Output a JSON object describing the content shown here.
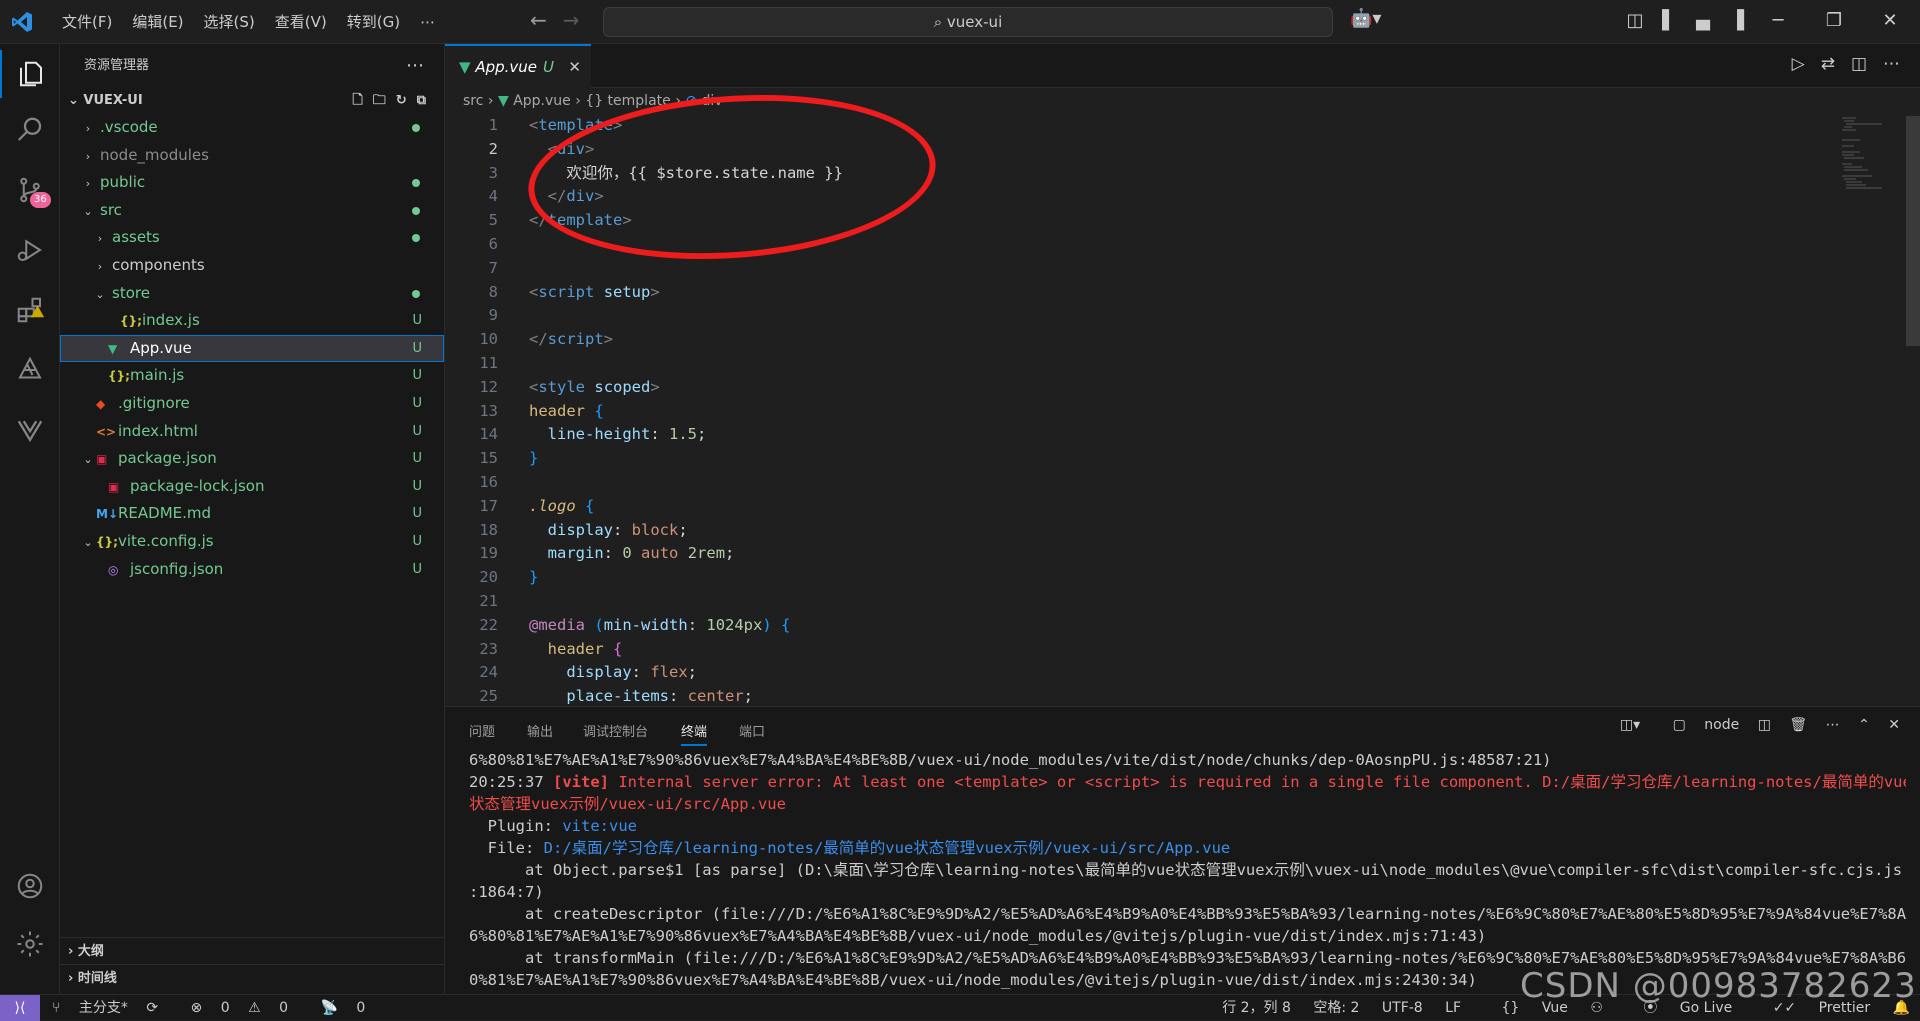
{
  "titlebar": {
    "menus": [
      "文件(F)",
      "编辑(E)",
      "选择(S)",
      "查看(V)",
      "转到(G)",
      "⋯"
    ],
    "search_text": "vuex-ui"
  },
  "activity": {
    "scm_badge": "36"
  },
  "sidebar": {
    "title": "资源管理器",
    "root": "VUEX-UI",
    "items": [
      {
        "label": ".vscode",
        "depth": 1,
        "kind": "folder",
        "status": "dot",
        "color": "#73c991"
      },
      {
        "label": "node_modules",
        "depth": 1,
        "kind": "folder",
        "status": "",
        "color": "#8c8c8c"
      },
      {
        "label": "public",
        "depth": 1,
        "kind": "folder",
        "status": "dot",
        "color": "#73c991"
      },
      {
        "label": "src",
        "depth": 1,
        "kind": "folder-open",
        "status": "dot",
        "color": "#73c991"
      },
      {
        "label": "assets",
        "depth": 2,
        "kind": "folder",
        "status": "dot",
        "color": "#73c991"
      },
      {
        "label": "components",
        "depth": 2,
        "kind": "folder",
        "status": "",
        "color": "#cccccc"
      },
      {
        "label": "store",
        "depth": 2,
        "kind": "folder-open",
        "status": "dot",
        "color": "#73c991"
      },
      {
        "label": "index.js",
        "depth": 3,
        "kind": "js",
        "status": "U",
        "color": "#73c991"
      },
      {
        "label": "App.vue",
        "depth": 2,
        "kind": "vue",
        "status": "U",
        "color": "#ffffff",
        "selected": true
      },
      {
        "label": "main.js",
        "depth": 2,
        "kind": "js",
        "status": "U",
        "color": "#73c991"
      },
      {
        "label": ".gitignore",
        "depth": 1,
        "kind": "git",
        "status": "U",
        "color": "#73c991"
      },
      {
        "label": "index.html",
        "depth": 1,
        "kind": "html",
        "status": "U",
        "color": "#73c991"
      },
      {
        "label": "package.json",
        "depth": 1,
        "kind": "pkg-open",
        "status": "U",
        "color": "#73c991"
      },
      {
        "label": "package-lock.json",
        "depth": 2,
        "kind": "pkg",
        "status": "U",
        "color": "#73c991"
      },
      {
        "label": "README.md",
        "depth": 1,
        "kind": "md",
        "status": "U",
        "color": "#73c991"
      },
      {
        "label": "vite.config.js",
        "depth": 1,
        "kind": "js-open",
        "status": "U",
        "color": "#73c991"
      },
      {
        "label": "jsconfig.json",
        "depth": 2,
        "kind": "jsconfig",
        "status": "U",
        "color": "#73c991"
      }
    ],
    "outline": "大纲",
    "timeline": "时间线"
  },
  "editor": {
    "tab_label": "App.vue",
    "tab_status": "U",
    "breadcrumb": [
      "src",
      "App.vue",
      "template",
      "div"
    ],
    "current_line": 2
  },
  "panel": {
    "tabs": [
      "问题",
      "输出",
      "调试控制台",
      "终端",
      "端口"
    ],
    "active_tab": "终端",
    "terminal_name": "node",
    "lines": [
      {
        "t": "6%80%81%E7%AE%A1%E7%90%86vuex%E7%A4%BA%E4%BE%8B/vuex-ui/node_modules/vite/dist/node/chunks/dep-0AosnpPU.js:48587:21)",
        "c": "w"
      },
      {
        "t": "20:25:37 [vite] Internal server error: At least one <template> or <script> is required in a single file component. D:/桌面/学习仓库/learning-notes/最简单的vue",
        "c": "err"
      },
      {
        "t": "状态管理vuex示例/vuex-ui/src/App.vue",
        "c": "r"
      },
      {
        "t": "  Plugin: vite:vue",
        "c": "plugin"
      },
      {
        "t": "  File: D:/桌面/学习仓库/learning-notes/最简单的vue状态管理vuex示例/vuex-ui/src/App.vue",
        "c": "file"
      },
      {
        "t": "      at Object.parse$1 [as parse] (D:\\桌面\\学习仓库\\learning-notes\\最简单的vue状态管理vuex示例\\vuex-ui\\node_modules\\@vue\\compiler-sfc\\dist\\compiler-sfc.cjs.js",
        "c": "w"
      },
      {
        "t": ":1864:7)",
        "c": "w"
      },
      {
        "t": "      at createDescriptor (file:///D:/%E6%A1%8C%E9%9D%A2/%E5%AD%A6%E4%B9%A0%E4%BB%93%E5%BA%93/learning-notes/%E6%9C%80%E7%AE%80%E5%8D%95%E7%9A%84vue%E7%8A%B6%E6",
        "c": "w"
      },
      {
        "t": "6%80%81%E7%AE%A1%E7%90%86vuex%E7%A4%BA%E4%BE%8B/vuex-ui/node_modules/@vitejs/plugin-vue/dist/index.mjs:71:43)",
        "c": "w"
      },
      {
        "t": "      at transformMain (file:///D:/%E6%A1%8C%E9%9D%A2/%E5%AD%A6%E4%B9%A0%E4%BB%93%E5%BA%93/learning-notes/%E6%9C%80%E7%AE%80%E5%8D%95%E7%9A%84vue%E7%8A%B6%E6%",
        "c": "w"
      },
      {
        "t": "0%81%E7%AE%A1%E7%90%86vuex%E7%A4%BA%E4%BE%8B/vuex-ui/node_modules/@vitejs/plugin-vue/dist/index.mjs:2430:34)",
        "c": "w"
      }
    ]
  },
  "statusbar": {
    "branch": "主分支*",
    "errors": "0",
    "warnings": "0",
    "ports": "0",
    "position": "行 2，列 8",
    "spaces": "空格: 2",
    "encoding": "UTF-8",
    "eol": "LF",
    "language": "Vue",
    "golive": "Go Live",
    "prettier": "Prettier"
  },
  "watermark": "CSDN @00983782623",
  "colors": {
    "accent": "#0078d4",
    "annotation": "#ee1c1c",
    "untracked": "#73c991",
    "error": "#f14c4c"
  }
}
